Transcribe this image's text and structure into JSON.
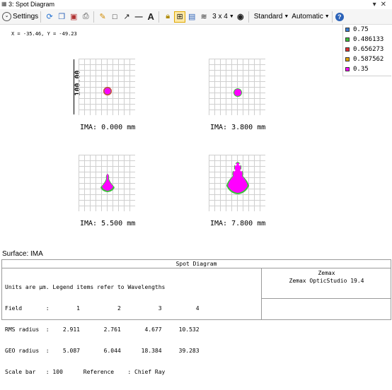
{
  "window": {
    "title": "3: Spot Diagram"
  },
  "toolbar": {
    "settings_label": "Settings",
    "layout_label": "3 x 4",
    "standard_label": "Standard",
    "automatic_label": "Automatic"
  },
  "coords": "X = -35.46, Y = -49.23",
  "legend": [
    {
      "label": "0.75",
      "color": "#3a7fd5"
    },
    {
      "label": "0.486133",
      "color": "#3cbf3c"
    },
    {
      "label": "0.656273",
      "color": "#e03030"
    },
    {
      "label": "0.587562",
      "color": "#e0a000"
    },
    {
      "label": "0.35",
      "color": "#ff00ff"
    }
  ],
  "scale_bar_label": "100.00",
  "fields": [
    {
      "ima": "IMA: 0.000 mm"
    },
    {
      "ima": "IMA: 3.800 mm"
    },
    {
      "ima": "IMA: 5.500 mm"
    },
    {
      "ima": "IMA: 7.800 mm"
    }
  ],
  "surface_label": "Surface: IMA",
  "info": {
    "header": "Spot Diagram",
    "lines": [
      "Units are µm. Legend items refer to Wavelengths",
      "Field       :        1           2           3          4",
      "RMS radius  :    2.911       2.761       4.677     10.532",
      "GEO radius  :    5.087       6.044      18.384     39.283",
      "Scale bar   : 100      Reference    : Chief Ray"
    ],
    "company": "Zemax",
    "product": "Zemax OpticStudio 19.4"
  }
}
